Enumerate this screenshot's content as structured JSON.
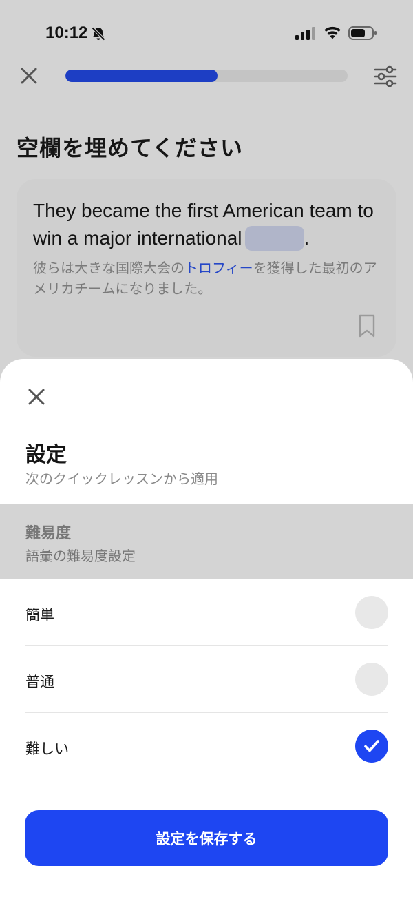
{
  "status_bar": {
    "time": "10:12",
    "icons": [
      "bell-off-icon",
      "signal-icon",
      "wifi-icon",
      "battery-icon"
    ]
  },
  "header": {
    "progress": 0.54,
    "progress_color": "#1d3ec4",
    "icons": [
      "close-icon",
      "sliders-icon"
    ]
  },
  "prompt": {
    "title": "空欄を埋めてください"
  },
  "question": {
    "sentence_before": "They became the first American team to win a major international",
    "sentence_after": ".",
    "translation_before": "彼らは大きな国際大会の",
    "translation_highlight": "トロフィー",
    "translation_after": "を獲得した最初のアメリカチームになりました。",
    "bookmark_icon": "bookmark-icon"
  },
  "sheet": {
    "title": "設定",
    "subtitle": "次のクイックレッスンから適用",
    "section": {
      "title": "難易度",
      "subtitle": "語彙の難易度設定"
    },
    "options": [
      {
        "label": "簡単",
        "selected": false
      },
      {
        "label": "普通",
        "selected": false
      },
      {
        "label": "難しい",
        "selected": true
      }
    ],
    "save_label": "設定を保存する",
    "accent_color": "#1e46f2"
  }
}
